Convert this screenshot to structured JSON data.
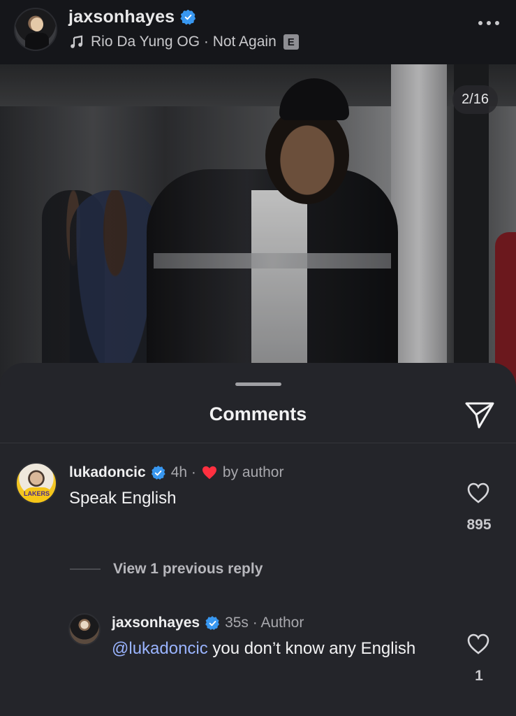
{
  "header": {
    "username": "jaxsonhayes",
    "music": "Rio Da Yung OG · Not Again",
    "explicit_badge": "E"
  },
  "photo": {
    "counter": "2/16"
  },
  "sheet": {
    "title": "Comments"
  },
  "comments": [
    {
      "username": "lukadoncic",
      "time": "4h ·",
      "author_like_label": "by author",
      "text": "Speak English",
      "likes": "895"
    }
  ],
  "view_replies": "View 1 previous reply",
  "reply": {
    "username": "jaxsonhayes",
    "meta": "35s · Author",
    "mention": "@lukadoncic",
    "text": " you don’t know any English",
    "likes": "1"
  },
  "colors": {
    "verified": "#3897f0",
    "liked_by_author_heart": "#ff3040",
    "mention": "#9ab4ff",
    "sheet_bg": "#24252a"
  },
  "icons": [
    "music-note-icon",
    "verified-icon",
    "more-icon",
    "share-icon",
    "heart-icon",
    "red-heart-icon"
  ]
}
